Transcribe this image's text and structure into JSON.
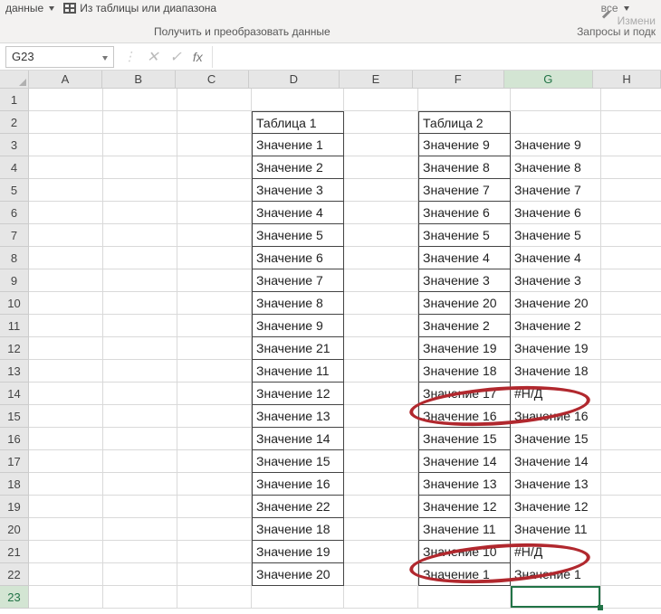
{
  "ribbon": {
    "left_item": "данные",
    "table_item": "Из таблицы или диапазона",
    "section_label": "Получить и преобразовать данные",
    "right_top_item": "все",
    "right_pencil": "Измени",
    "right_label": "Запросы и подк"
  },
  "namebox": {
    "value": "G23"
  },
  "fx": {
    "label": "fx"
  },
  "cols": [
    "A",
    "B",
    "C",
    "D",
    "E",
    "F",
    "G",
    "H"
  ],
  "rows": [
    "1",
    "2",
    "3",
    "4",
    "5",
    "6",
    "7",
    "8",
    "9",
    "10",
    "11",
    "12",
    "13",
    "14",
    "15",
    "16",
    "17",
    "18",
    "19",
    "20",
    "21",
    "22",
    "23"
  ],
  "active_cell": {
    "col": "G",
    "row": 23
  },
  "sheet": {
    "D": [
      "",
      "Таблица 1",
      "Значение 1",
      "Значение 2",
      "Значение 3",
      "Значение 4",
      "Значение 5",
      "Значение 6",
      "Значение 7",
      "Значение 8",
      "Значение 9",
      "Значение 21",
      "Значение 11",
      "Значение 12",
      "Значение 13",
      "Значение 14",
      "Значение 15",
      "Значение 16",
      "Значение 22",
      "Значение 18",
      "Значение 19",
      "Значение 20",
      ""
    ],
    "F": [
      "",
      "Таблица 2",
      "Значение 9",
      "Значение 8",
      "Значение 7",
      "Значение 6",
      "Значение 5",
      "Значение 4",
      "Значение 3",
      "Значение 20",
      "Значение 2",
      "Значение 19",
      "Значение 18",
      "Значение 17",
      "Значение 16",
      "Значение 15",
      "Значение 14",
      "Значение 13",
      "Значение 12",
      "Значение 11",
      "Значение 10",
      "Значение 1",
      ""
    ],
    "G": [
      "",
      "",
      "Значение 9",
      "Значение 8",
      "Значение 7",
      "Значение 6",
      "Значение 5",
      "Значение 4",
      "Значение 3",
      "Значение 20",
      "Значение 2",
      "Значение 19",
      "Значение 18",
      "#Н/Д",
      "Значение 16",
      "Значение 15",
      "Значение 14",
      "Значение 13",
      "Значение 12",
      "Значение 11",
      "#Н/Д",
      "Значение 1",
      ""
    ]
  }
}
